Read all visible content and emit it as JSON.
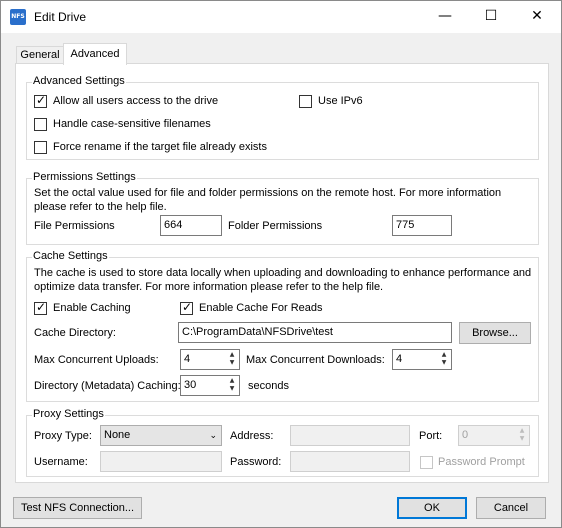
{
  "window": {
    "title": "Edit Drive",
    "app_icon_text": "NFS",
    "minimize_glyph": "—",
    "maximize_glyph": "☐",
    "close_glyph": "✕"
  },
  "tabs": [
    {
      "label": "General",
      "selected": false
    },
    {
      "label": "Advanced",
      "selected": true
    }
  ],
  "advanced": {
    "title": "Advanced Settings",
    "allow_all_users": {
      "label": "Allow all users access to the drive",
      "checked": true
    },
    "use_ipv6": {
      "label": "Use IPv6",
      "checked": false
    },
    "case_sensitive": {
      "label": "Handle case-sensitive filenames",
      "checked": false
    },
    "force_rename": {
      "label": "Force rename if the target file already exists",
      "checked": false
    }
  },
  "permissions": {
    "title": "Permissions Settings",
    "description": "Set the octal value used for file and folder permissions on the remote host. For more information please refer to the help file.",
    "file_label": "File Permissions",
    "file_value": "664",
    "folder_label": "Folder Permissions",
    "folder_value": "775"
  },
  "cache": {
    "title": "Cache Settings",
    "description": "The cache is used to store data locally when uploading and downloading to enhance performance and optimize data transfer. For more information please refer to the help file.",
    "enable_caching": {
      "label": "Enable Caching",
      "checked": true
    },
    "enable_reads": {
      "label": "Enable Cache For Reads",
      "checked": true
    },
    "directory_label": "Cache Directory:",
    "directory_value": "C:\\ProgramData\\NFSDrive\\test",
    "browse_label": "Browse...",
    "uploads_label": "Max Concurrent Uploads:",
    "uploads_value": "4",
    "downloads_label": "Max Concurrent Downloads:",
    "downloads_value": "4",
    "metadata_label": "Directory (Metadata) Caching:",
    "metadata_value": "30",
    "metadata_unit": "seconds"
  },
  "proxy": {
    "title": "Proxy Settings",
    "type_label": "Proxy Type:",
    "type_value": "None",
    "address_label": "Address:",
    "address_value": "",
    "port_label": "Port:",
    "port_value": "0",
    "username_label": "Username:",
    "username_value": "",
    "password_label": "Password:",
    "password_value": "",
    "password_prompt": {
      "label": "Password Prompt",
      "checked": false
    }
  },
  "footer": {
    "test_label": "Test NFS Connection...",
    "ok_label": "OK",
    "cancel_label": "Cancel"
  },
  "colors": {
    "accent": "#0078d7",
    "window_bg": "#f0f0f0"
  }
}
